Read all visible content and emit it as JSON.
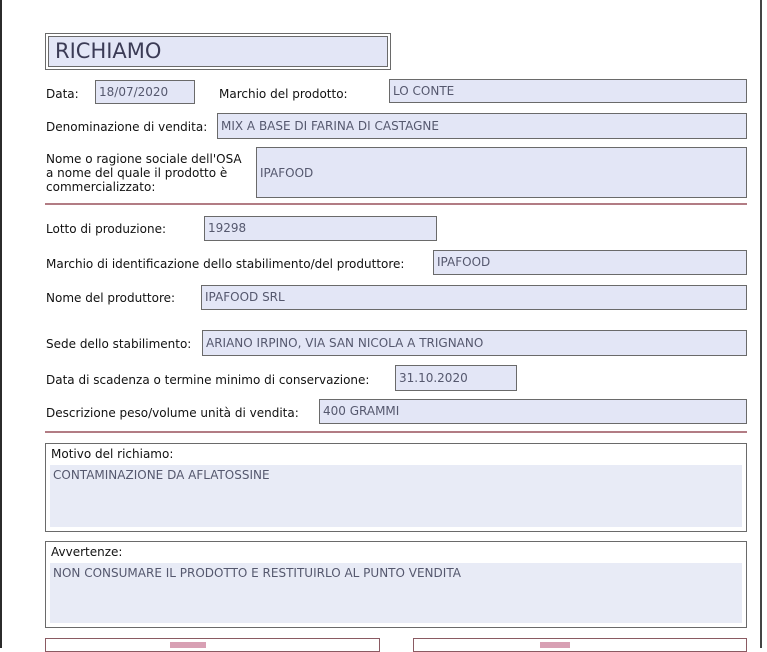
{
  "title": "RICHIAMO",
  "fields": {
    "data": {
      "label": "Data:",
      "value": "18/07/2020"
    },
    "marchio": {
      "label": "Marchio del prodotto:",
      "value": "LO CONTE"
    },
    "denominazione": {
      "label": "Denominazione di vendita:",
      "value": "MIX A BASE DI FARINA DI CASTAGNE"
    },
    "osa": {
      "label_lines": [
        "Nome o ragione sociale dell'OSA",
        "a nome del quale il prodotto è",
        "commercializzato:"
      ],
      "value": "IPAFOOD"
    },
    "lotto": {
      "label": "Lotto di produzione:",
      "value": "19298"
    },
    "marchio_id": {
      "label": "Marchio di identificazione dello stabilimento/del produttore:",
      "value": "IPAFOOD"
    },
    "produttore": {
      "label": "Nome del produttore:",
      "value": "IPAFOOD SRL"
    },
    "sede": {
      "label": "Sede dello stabilimento:",
      "value": "ARIANO IRPINO, VIA SAN NICOLA A TRIGNANO"
    },
    "scadenza": {
      "label": "Data di scadenza o termine minimo di conservazione:",
      "value": "31.10.2020"
    },
    "peso": {
      "label": "Descrizione peso/volume unità di vendita:",
      "value": "400 GRAMMI"
    }
  },
  "motivo": {
    "label": "Motivo del richiamo:",
    "value": "CONTAMINAZIONE DA AFLATOSSINE"
  },
  "avvertenze": {
    "label": "Avvertenze:",
    "value": "NON CONSUMARE IL PRODOTTO E RESTITUIRLO AL PUNTO VENDITA"
  }
}
